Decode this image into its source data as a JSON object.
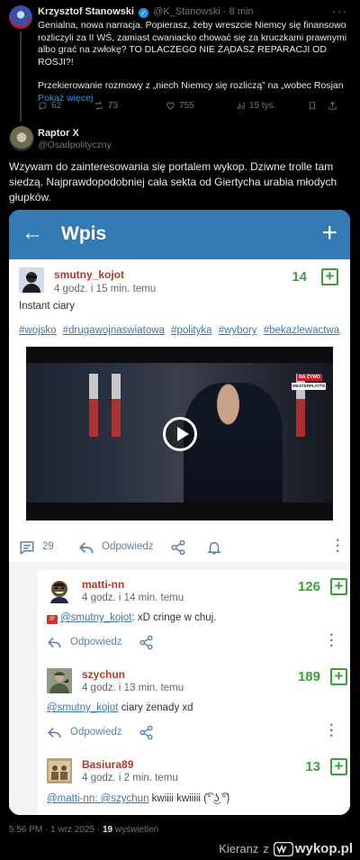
{
  "quoted_tweet": {
    "author_name": "Krzysztof Stanowski",
    "author_handle": "@K_Stanowski",
    "time": "8 min",
    "text_1": "Genialna, nowa narracja. Popierasz, żeby wreszcie Niemcy się finansowo rozliczyli za II WŚ, zamiast cwaniacko chować się za kruczkami prawnymi albo grać na zwłokę? TO DLACZEGO NIE ŻĄDASZ REPARACJI OD ROSJI?!",
    "text_2": "Przekierowanie rozmowy z „niech Niemcy się rozliczą” na „wobec Rosjan",
    "show_more": "Pokaż więcej",
    "replies": "62",
    "retweets": "73",
    "likes": "755",
    "views": "15 tys."
  },
  "tweet": {
    "author_name": "Raptor X",
    "author_handle": "@Osadpolityczny",
    "text": "Wzywam do zainteresowania się portalem wykop. Dziwne trolle tam siedzą. Najprawdopodobniej cała sekta od Giertycha urabia młodych głupków.",
    "timestamp": "5:56 PM · 1 wrz 2025 · ",
    "views_count": "19",
    "views_label": " wyświetleń"
  },
  "wykop": {
    "header_title": "Wpis",
    "entry": {
      "username": "smutny_kojot",
      "time": "4 godz. i 15 min. temu",
      "votes": "14",
      "body": "Instant ciary",
      "tags": [
        "#wojsko",
        "#drugawojnaswiatowa",
        "#polityka",
        "#wybory",
        "#bekazlewactwa"
      ],
      "video_badge_live": "NA ŻYWO",
      "video_badge_location": "WESTERPLATTE",
      "comments_count": "29",
      "reply_label": "Odpowiedz"
    },
    "comments": [
      {
        "username": "matti-nn",
        "time": "4 godz. i 14 min. temu",
        "votes": "126",
        "mention": "@smutny_kojot",
        "text": ":  xD cringe w chuj.",
        "reply_label": "Odpowiedz"
      },
      {
        "username": "szychun",
        "time": "4 godz. i 13 min. temu",
        "votes": "189",
        "mention": "@smutny_kojot",
        "text": " ciary żenady xd",
        "reply_label": "Odpowiedz"
      },
      {
        "username": "Basiura89",
        "time": "4 godz. i 2 min. temu",
        "votes": "13",
        "mention": "@matti-nn: @szychun",
        "text": " kwiiii kwiiiii (͡° ͜ʖ ͡°)",
        "reply_label": "Odpowiedz"
      }
    ]
  },
  "watermark": {
    "user": "Kieranz",
    "separator": "z",
    "site": "wykop.pl"
  },
  "colors": {
    "wykop_blue": "#347bb4",
    "vote_green": "#3c9e3c",
    "username_red": "#b23a26",
    "twitter_link": "#1d9bf0"
  }
}
